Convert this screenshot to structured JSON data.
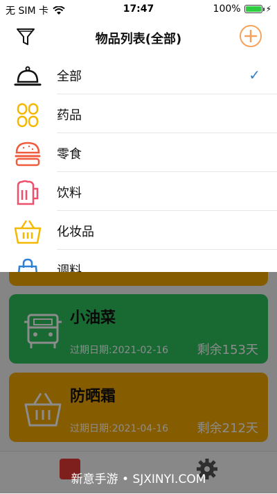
{
  "status_bar": {
    "carrier": "无 SIM 卡",
    "time": "17:47",
    "battery_pct": "100%",
    "battery_level": 1.0
  },
  "header": {
    "title": "物品列表(全部)"
  },
  "menu": {
    "selected_index": 0,
    "items": [
      {
        "label": "全部",
        "icon": "cloche-icon",
        "color": "#111111"
      },
      {
        "label": "药品",
        "icon": "pills-icon",
        "color": "#f5b800"
      },
      {
        "label": "零食",
        "icon": "burger-icon",
        "color": "#ef5b3c"
      },
      {
        "label": "饮料",
        "icon": "beer-mug-icon",
        "color": "#ef4f6a"
      },
      {
        "label": "化妆品",
        "icon": "basket-icon",
        "color": "#f5b800"
      },
      {
        "label": "调料",
        "icon": "shopping-bag-icon",
        "color": "#2f7fd3"
      }
    ]
  },
  "items": [
    {
      "name": "小油菜",
      "date": "过期日期:2021-02-16",
      "remain": "剩余153天",
      "color": "#2fbf5e",
      "icon": "vehicle-icon"
    },
    {
      "name": "防晒霜",
      "date": "过期日期:2021-04-16",
      "remain": "剩余212天",
      "color": "#f5a800",
      "icon": "basket-icon"
    }
  ],
  "watermark": "新意手游 • SJXINYI.COM"
}
